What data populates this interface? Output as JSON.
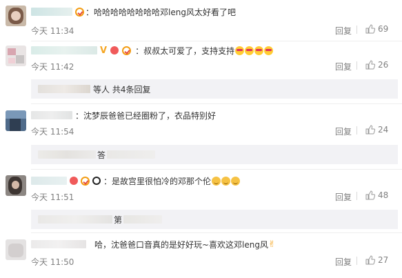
{
  "ui": {
    "reply_label": "回复",
    "icons": {
      "like": "thumbs-up-icon",
      "reply": "reply-link"
    },
    "colors": {
      "meta": "#808080",
      "subbox_bg": "#f2f2f5",
      "text": "#333333"
    }
  },
  "comments": [
    {
      "text": "：哈哈哈哈哈哈哈哈邓leng风太好看了吧",
      "time": "今天 11:34",
      "likes": "69"
    },
    {
      "text": "：叔叔太可爱了，支持支持",
      "time": "今天 11:42",
      "likes": "26",
      "sub_reply": "等人 共4条回复"
    },
    {
      "text": "：沈梦辰爸爸已经圈粉了，衣品特别好",
      "time": "今天 11:54",
      "likes": "24",
      "sub_reply": "答"
    },
    {
      "text": "：是故宫里很怕冷的邓那个伦",
      "time": "今天 11:51",
      "likes": "48",
      "sub_reply": "第"
    },
    {
      "text": "哈，沈爸爸口音真的是好好玩~喜欢这邓leng风",
      "time": "今天 11:50",
      "likes": "27"
    }
  ]
}
